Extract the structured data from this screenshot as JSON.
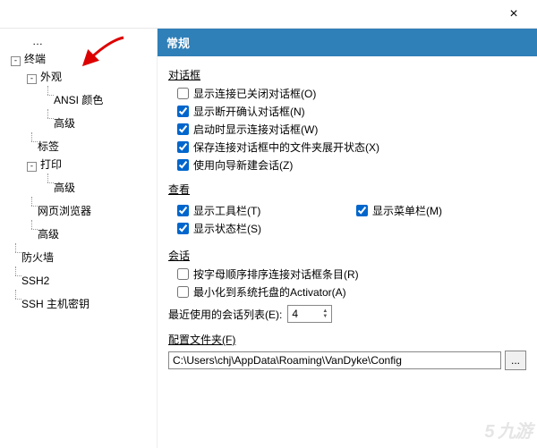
{
  "titlebar": {
    "close": "×"
  },
  "tree": {
    "node_truncated": "…",
    "terminal": "终端",
    "appearance": "外观",
    "ansi_color": "ANSI 颜色",
    "advanced": "高级",
    "tabs": "标签",
    "print": "打印",
    "print_adv": "高级",
    "browser": "网页浏览器",
    "adv2": "高级",
    "firewall": "防火墙",
    "ssh2": "SSH2",
    "ssh_hostkey": "SSH 主机密钥"
  },
  "header": {
    "title": "常规"
  },
  "dialog": {
    "group": "对话框",
    "show_closed": "显示连接已关闭对话框(O)",
    "show_disconnect": "显示断开确认对话框(N)",
    "show_startup": "启动时显示连接对话框(W)",
    "save_folder_state": "保存连接对话框中的文件夹展开状态(X)",
    "use_wizard": "使用向导新建会话(Z)"
  },
  "view": {
    "group": "查看",
    "toolbar": "显示工具栏(T)",
    "menubar": "显示菜单栏(M)",
    "statusbar": "显示状态栏(S)"
  },
  "session": {
    "group": "会话",
    "alpha_sort": "按字母顺序排序连接对话框条目(R)",
    "minimize_tray": "最小化到系统托盘的Activator(A)",
    "mru_label": "最近使用的会话列表(E):",
    "mru_value": "4"
  },
  "config": {
    "label": "配置文件夹(F)",
    "path": "C:\\Users\\chj\\AppData\\Roaming\\VanDyke\\Config",
    "browse": "..."
  },
  "watermark": "5 九游"
}
